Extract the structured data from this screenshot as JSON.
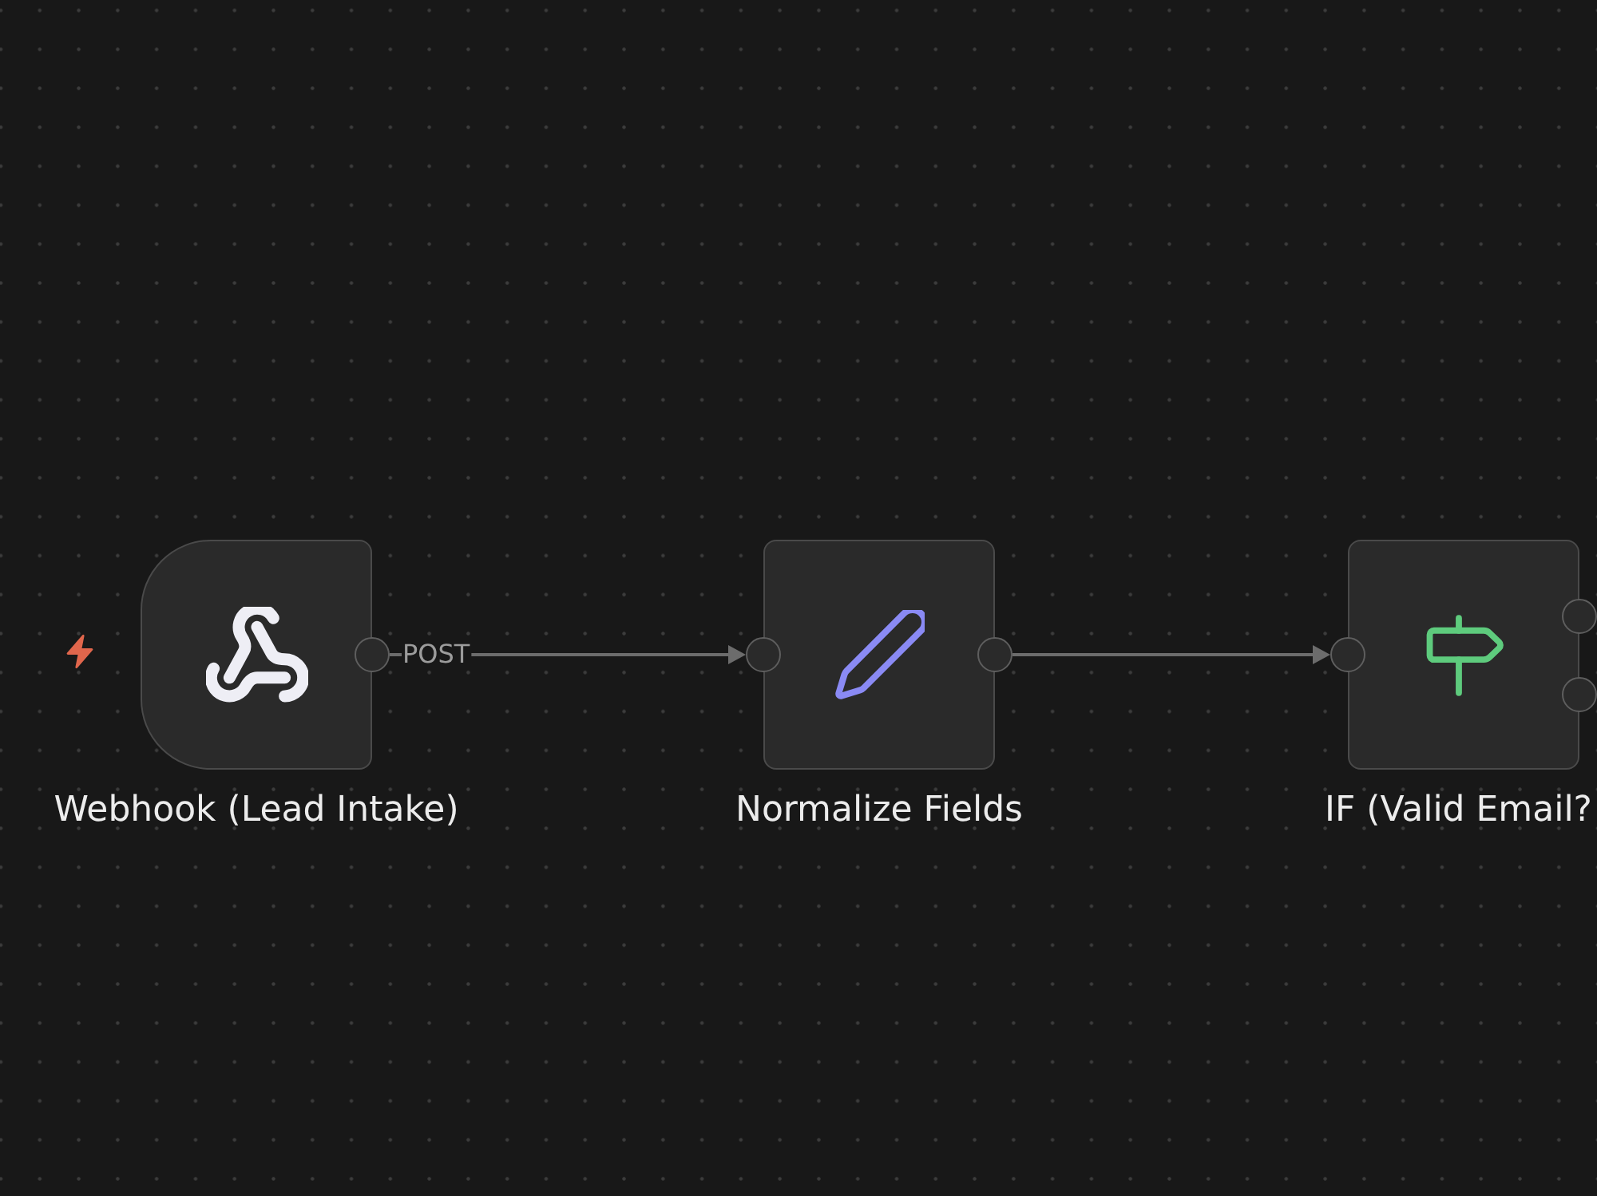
{
  "canvas": {
    "nodes": [
      {
        "kind": "webhook",
        "trigger": true,
        "label": "Webhook (Lead Intake)"
      },
      {
        "kind": "set",
        "trigger": false,
        "label": "Normalize Fields"
      },
      {
        "kind": "if",
        "trigger": false,
        "label": "IF (Valid Email?"
      }
    ],
    "edges": [
      {
        "kind": "main",
        "label": "POST"
      },
      {
        "kind": "main"
      }
    ]
  }
}
